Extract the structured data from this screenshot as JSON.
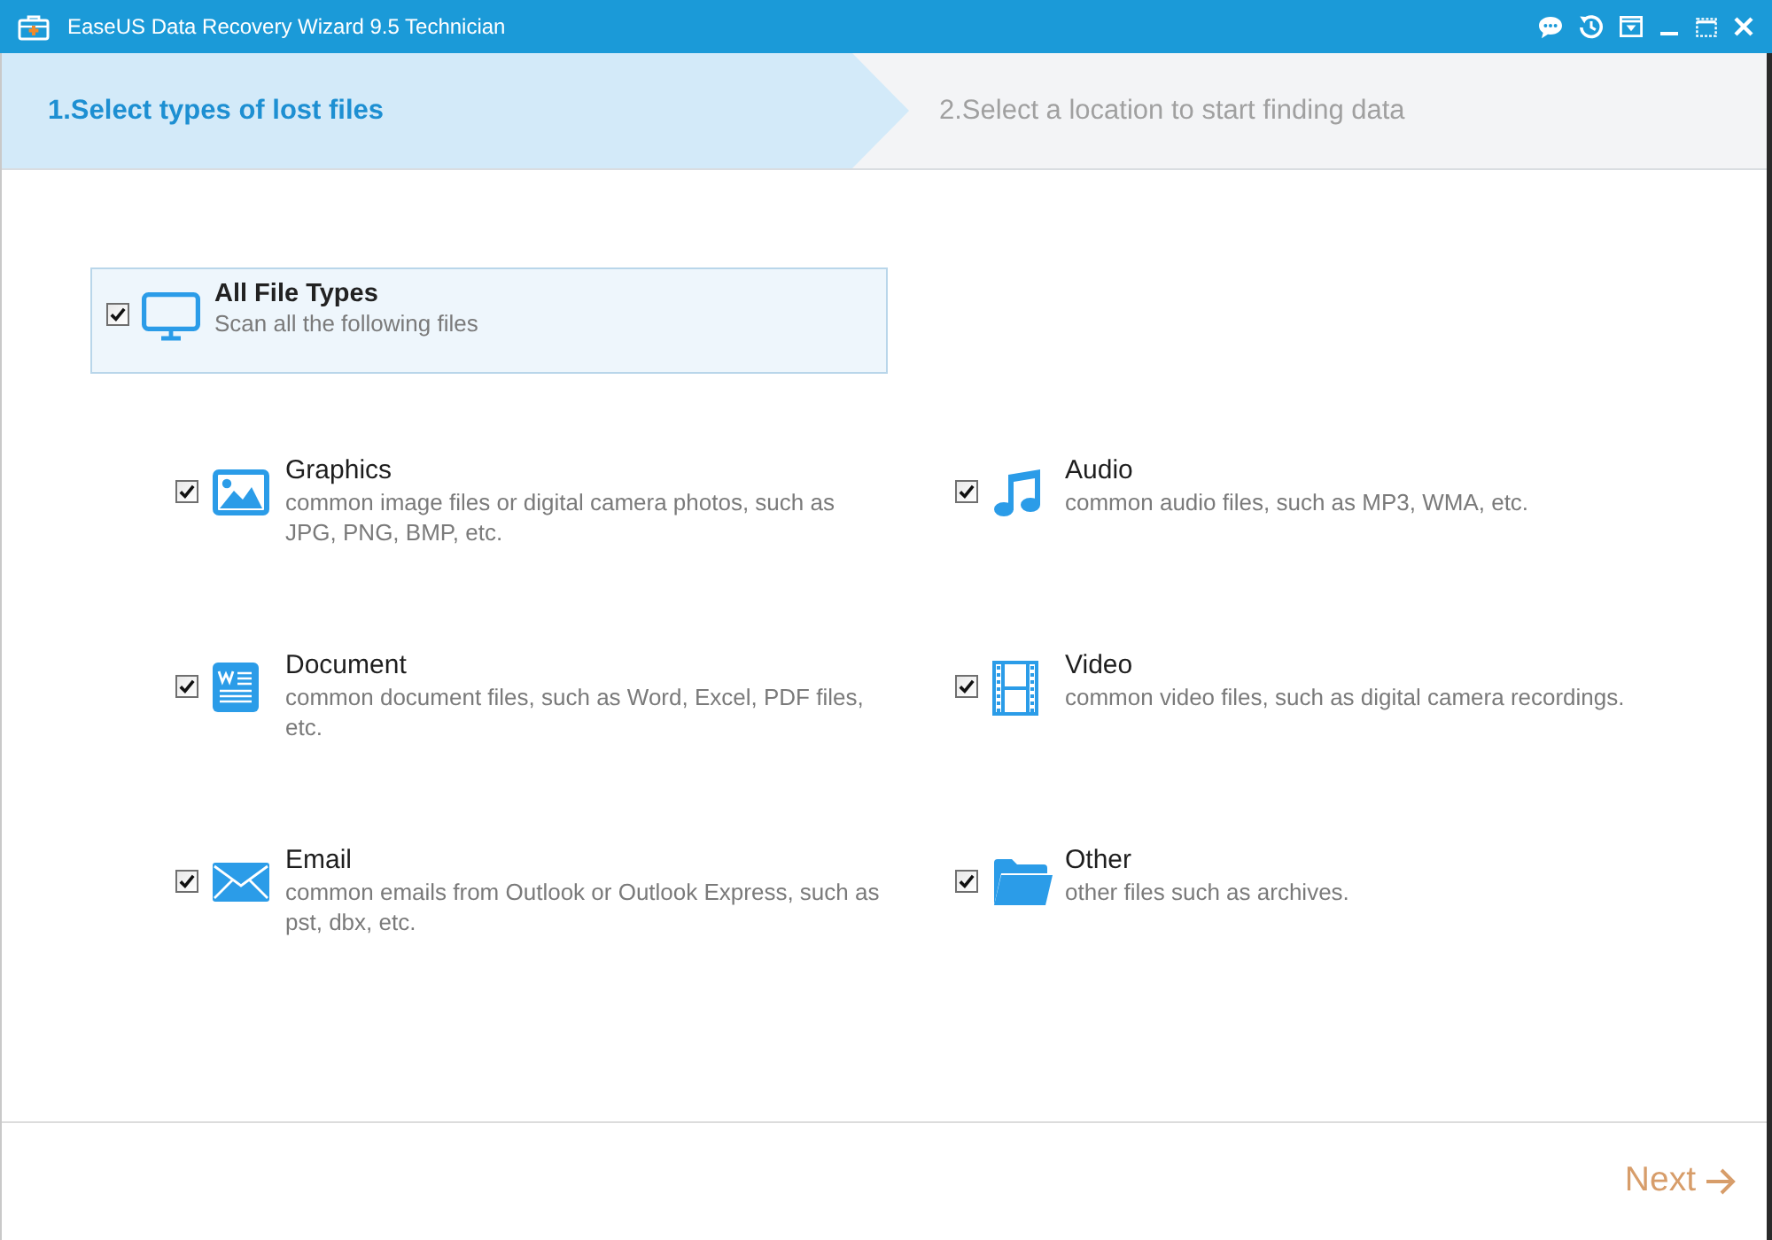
{
  "window": {
    "title": "EaseUS Data Recovery Wizard 9.5 Technician"
  },
  "steps": [
    {
      "label": "1.Select types of lost files",
      "selected": true
    },
    {
      "label": "2.Select a location to start finding data",
      "selected": false
    }
  ],
  "all_types": {
    "title": "All File Types",
    "description": "Scan all the following files",
    "checked": true
  },
  "file_types": [
    {
      "kind": "graphics",
      "title": "Graphics",
      "description": "common image files or digital camera photos, such as JPG, PNG, BMP, etc.",
      "checked": true
    },
    {
      "kind": "audio",
      "title": "Audio",
      "description": "common audio files, such as MP3, WMA, etc.",
      "checked": true
    },
    {
      "kind": "document",
      "title": "Document",
      "description": "common document files, such as Word, Excel, PDF files, etc.",
      "checked": true
    },
    {
      "kind": "video",
      "title": "Video",
      "description": "common video files, such as digital camera recordings.",
      "checked": true
    },
    {
      "kind": "email",
      "title": "Email",
      "description": "common emails from Outlook or Outlook Express, such as pst, dbx, etc.",
      "checked": true
    },
    {
      "kind": "other",
      "title": "Other",
      "description": "other files such as archives.",
      "checked": true
    }
  ],
  "next_button": {
    "label": "Next"
  }
}
